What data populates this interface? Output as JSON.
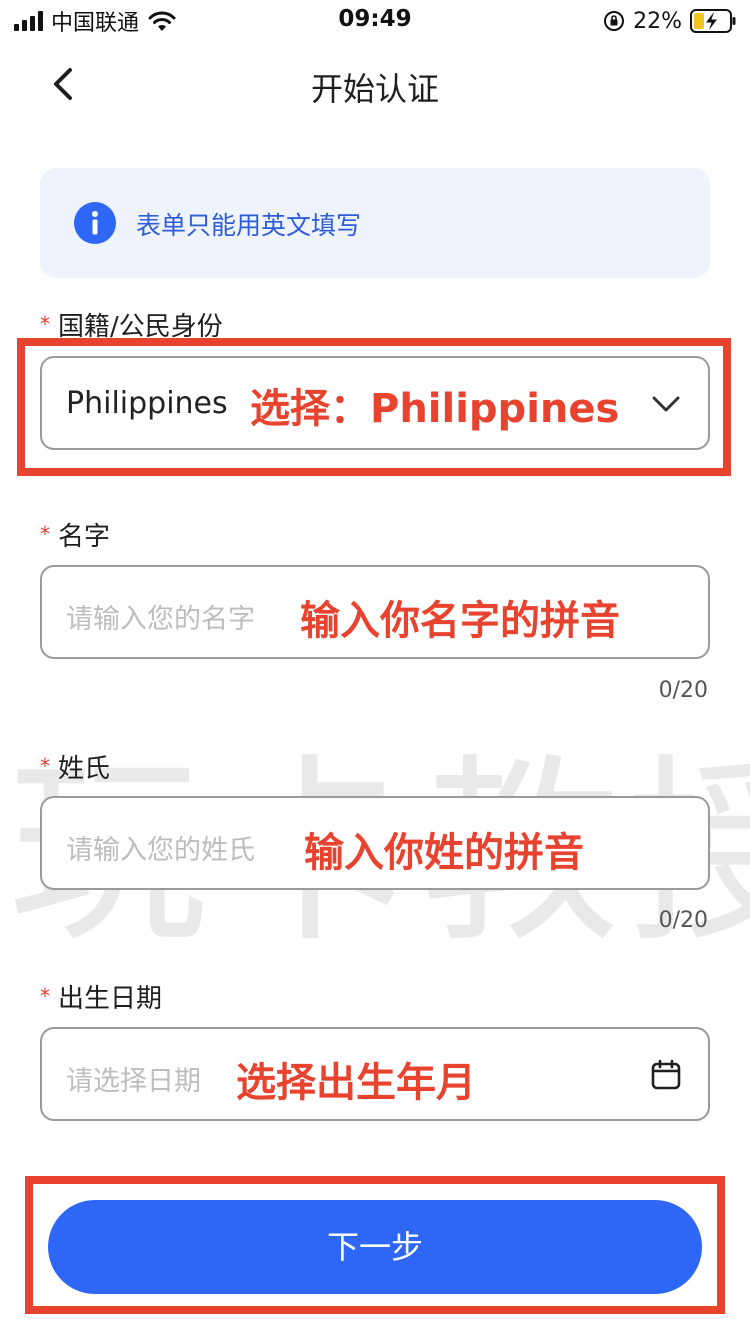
{
  "status_bar": {
    "carrier": "中国联通",
    "time": "09:49",
    "battery": "22%"
  },
  "nav": {
    "title": "开始认证"
  },
  "info_banner": {
    "text": "表单只能用英文填写"
  },
  "form": {
    "required_mark": "*",
    "nationality": {
      "label": "国籍/公民身份",
      "value": "Philippines"
    },
    "first_name": {
      "label": "名字",
      "placeholder": "请输入您的名字",
      "counter": "0/20"
    },
    "last_name": {
      "label": "姓氏",
      "placeholder": "请输入您的姓氏",
      "counter": "0/20"
    },
    "birth_date": {
      "label": "出生日期",
      "placeholder": "请选择日期"
    }
  },
  "annotations": {
    "nationality": "选择：Philippines",
    "first_name": "输入你名字的拼音",
    "last_name": "输入你姓的拼音",
    "birth_date": "选择出生年月"
  },
  "watermark": "玩卡教授",
  "next_button": {
    "label": "下一步"
  },
  "colors": {
    "primary": "#2e67f6",
    "annotation": "#e8432f",
    "required": "#e53a2c",
    "info_bg": "#eef3fe",
    "info_text": "#2f5cd9"
  },
  "icons": [
    "signal-icon",
    "wifi-icon",
    "orientation-lock-icon",
    "battery-charging-icon",
    "back-arrow-icon",
    "info-icon",
    "chevron-down-icon",
    "calendar-icon"
  ]
}
